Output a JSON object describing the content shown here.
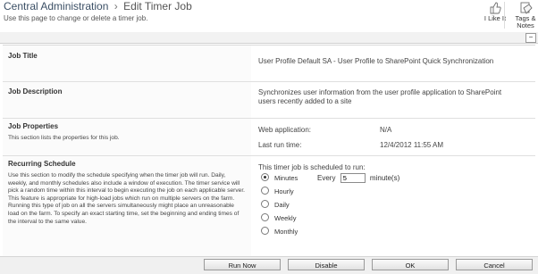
{
  "breadcrumb": {
    "root": "Central Administration",
    "separator": "›",
    "current": "Edit Timer Job"
  },
  "subtitle": "Use this page to change or delete a timer job.",
  "ribbon": {
    "like_label": "I Like It",
    "tags_label_line1": "Tags &",
    "tags_label_line2": "Notes"
  },
  "sections": {
    "job_title": {
      "title": "Job Title",
      "value": "User Profile Default SA - User Profile to SharePoint Quick Synchronization"
    },
    "job_description": {
      "title": "Job Description",
      "value": "Synchronizes user information from the user profile application to SharePoint users recently added to a site"
    },
    "job_properties": {
      "title": "Job Properties",
      "desc": "This section lists the properties for this job.",
      "web_application_label": "Web application:",
      "web_application_value": "N/A",
      "last_run_label": "Last run time:",
      "last_run_value": "12/4/2012 11:55 AM"
    },
    "recurring_schedule": {
      "title": "Recurring Schedule",
      "desc": "Use this section to modify the schedule specifying when the timer job will run. Daily, weekly, and monthly schedules also include a window of execution. The timer service will pick a random time within this interval to begin executing the job on each applicable server. This feature is appropriate for high-load jobs which run on multiple servers on the farm. Running this type of job on all the servers simultaneously might place an unreasonable load on the farm. To specify an exact starting time, set the beginning and ending times of the interval to the same value.",
      "scheduled_label": "This timer job is scheduled to run:",
      "options": [
        "Minutes",
        "Hourly",
        "Daily",
        "Weekly",
        "Monthly"
      ],
      "selected": "Minutes",
      "every_label": "Every",
      "every_value": "5",
      "every_unit": "minute(s)"
    }
  },
  "buttons": {
    "run_now": "Run Now",
    "disable": "Disable",
    "ok": "OK",
    "cancel": "Cancel"
  }
}
